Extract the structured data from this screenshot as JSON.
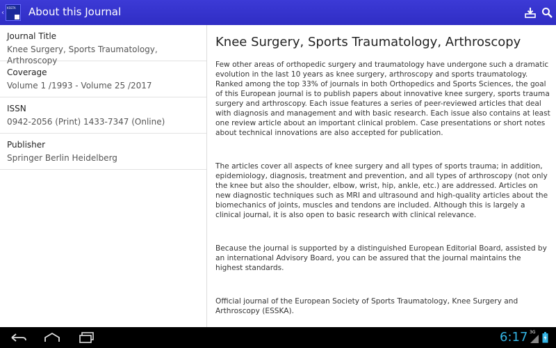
{
  "app": {
    "icon_text": "KSSTA",
    "title": "About this Journal"
  },
  "toolbar": {
    "download_icon": "download-icon",
    "search_icon": "search-icon"
  },
  "info": [
    {
      "label": "Journal Title",
      "value": "Knee Surgery, Sports Traumatology, Arthroscopy"
    },
    {
      "label": "Coverage",
      "value": "Volume 1 /1993 - Volume 25 /2017"
    },
    {
      "label": "ISSN",
      "value": "0942-2056 (Print) 1433-7347 (Online)"
    },
    {
      "label": "Publisher",
      "value": "Springer Berlin Heidelberg"
    }
  ],
  "content": {
    "heading": "Knee Surgery, Sports Traumatology, Arthroscopy",
    "paragraphs": [
      "Few other areas of orthopedic surgery and traumatology have undergone such a dramatic evolution in the last 10 years as knee surgery, arthroscopy and sports traumatology. Ranked among the top 33% of journals in both Orthopedics and Sports Sciences, the goal of this European journal is to publish papers about innovative knee surgery, sports trauma surgery and arthroscopy. Each issue features a series of peer-reviewed articles that deal with diagnosis and management and with basic research. Each issue also contains at least one review article about an important clinical problem. Case presentations or short notes about technical innovations are also accepted for publication.",
      "The articles cover all aspects of knee surgery and all types of sports trauma; in addition, epidemiology, diagnosis, treatment and prevention, and all types of arthroscopy (not only the knee but also the shoulder, elbow, wrist, hip, ankle, etc.) are addressed. Articles on new diagnostic techniques such as MRI and ultrasound and high-quality articles about the biomechanics of joints, muscles and tendons are included. Although this is largely a clinical journal, it is also open to basic research with clinical relevance.",
      "Because the journal is supported by a distinguished European Editorial Board, assisted by an international Advisory Board, you can be assured that the journal maintains the highest standards.",
      "Official journal of the European Society of Sports Traumatology, Knee Surgery and Arthroscopy (ESSKA)."
    ]
  },
  "statusbar": {
    "time": "6:17",
    "network": "3G",
    "accent_color": "#33b5e5"
  },
  "colors": {
    "actionbar": "#3432cc",
    "navbar": "#000000"
  }
}
